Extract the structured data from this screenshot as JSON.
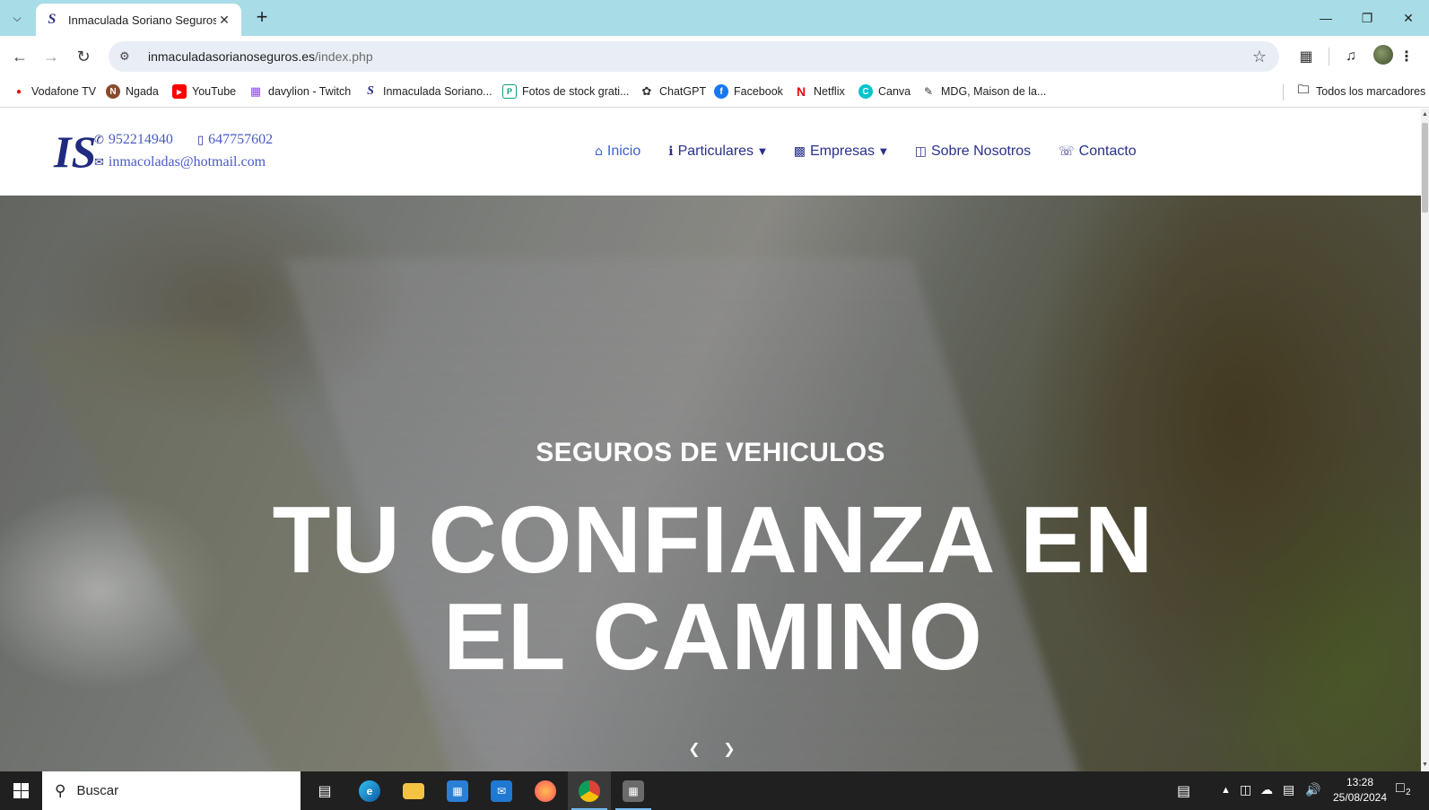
{
  "browser": {
    "tab_title": "Inmaculada Soriano Seguros",
    "url_domain": "inmaculadasorianoseguros.es",
    "url_path": "/index.php"
  },
  "bookmarks": [
    {
      "label": "Vodafone TV",
      "icon": "vodafone-icon",
      "color": "#e60000"
    },
    {
      "label": "Ngada",
      "icon": "ngada-icon",
      "color": "#8b4a2b"
    },
    {
      "label": "YouTube",
      "icon": "youtube-icon",
      "color": "#ff0000"
    },
    {
      "label": "davylion - Twitch",
      "icon": "twitch-icon",
      "color": "#9146ff"
    },
    {
      "label": "Inmaculada Soriano...",
      "icon": "site-favicon-icon",
      "color": "#2c2f86"
    },
    {
      "label": "Fotos de stock grati...",
      "icon": "pexels-icon",
      "color": "#05a081"
    },
    {
      "label": "ChatGPT",
      "icon": "chatgpt-icon",
      "color": "#333333"
    },
    {
      "label": "Facebook",
      "icon": "facebook-icon",
      "color": "#1877f2"
    },
    {
      "label": "Netflix",
      "icon": "netflix-icon",
      "color": "#e50914"
    },
    {
      "label": "Canva",
      "icon": "canva-icon",
      "color": "#00c4cc"
    },
    {
      "label": "MDG, Maison de la...",
      "icon": "mdg-icon",
      "color": "#333333"
    }
  ],
  "all_bookmarks_label": "Todos los marcadores",
  "site": {
    "logo_text": "IS",
    "phone": "952214940",
    "mobile": "647757602",
    "email": "inmacoladas@hotmail.com",
    "nav": [
      {
        "label": "Inicio",
        "icon": "home-icon",
        "active": true
      },
      {
        "label": "Particulares",
        "icon": "person-icon",
        "dropdown": true
      },
      {
        "label": "Empresas",
        "icon": "industry-icon",
        "dropdown": true
      },
      {
        "label": "Sobre Nosotros",
        "icon": "id-card-icon"
      },
      {
        "label": "Contacto",
        "icon": "contact-icon"
      }
    ],
    "hero": {
      "kicker": "SEGUROS DE VEHICULOS",
      "title": "TU CONFIANZA EN EL CAMINO"
    }
  },
  "taskbar": {
    "search_placeholder": "Buscar",
    "time": "13:28",
    "date": "25/08/2024",
    "notification_count": "2"
  },
  "colors": {
    "tabstrip": "#a8dde7",
    "nav_text": "#2a3188",
    "nav_active": "#3a62d8",
    "contact_link": "#4a59c7",
    "logo": "#202a7e"
  }
}
